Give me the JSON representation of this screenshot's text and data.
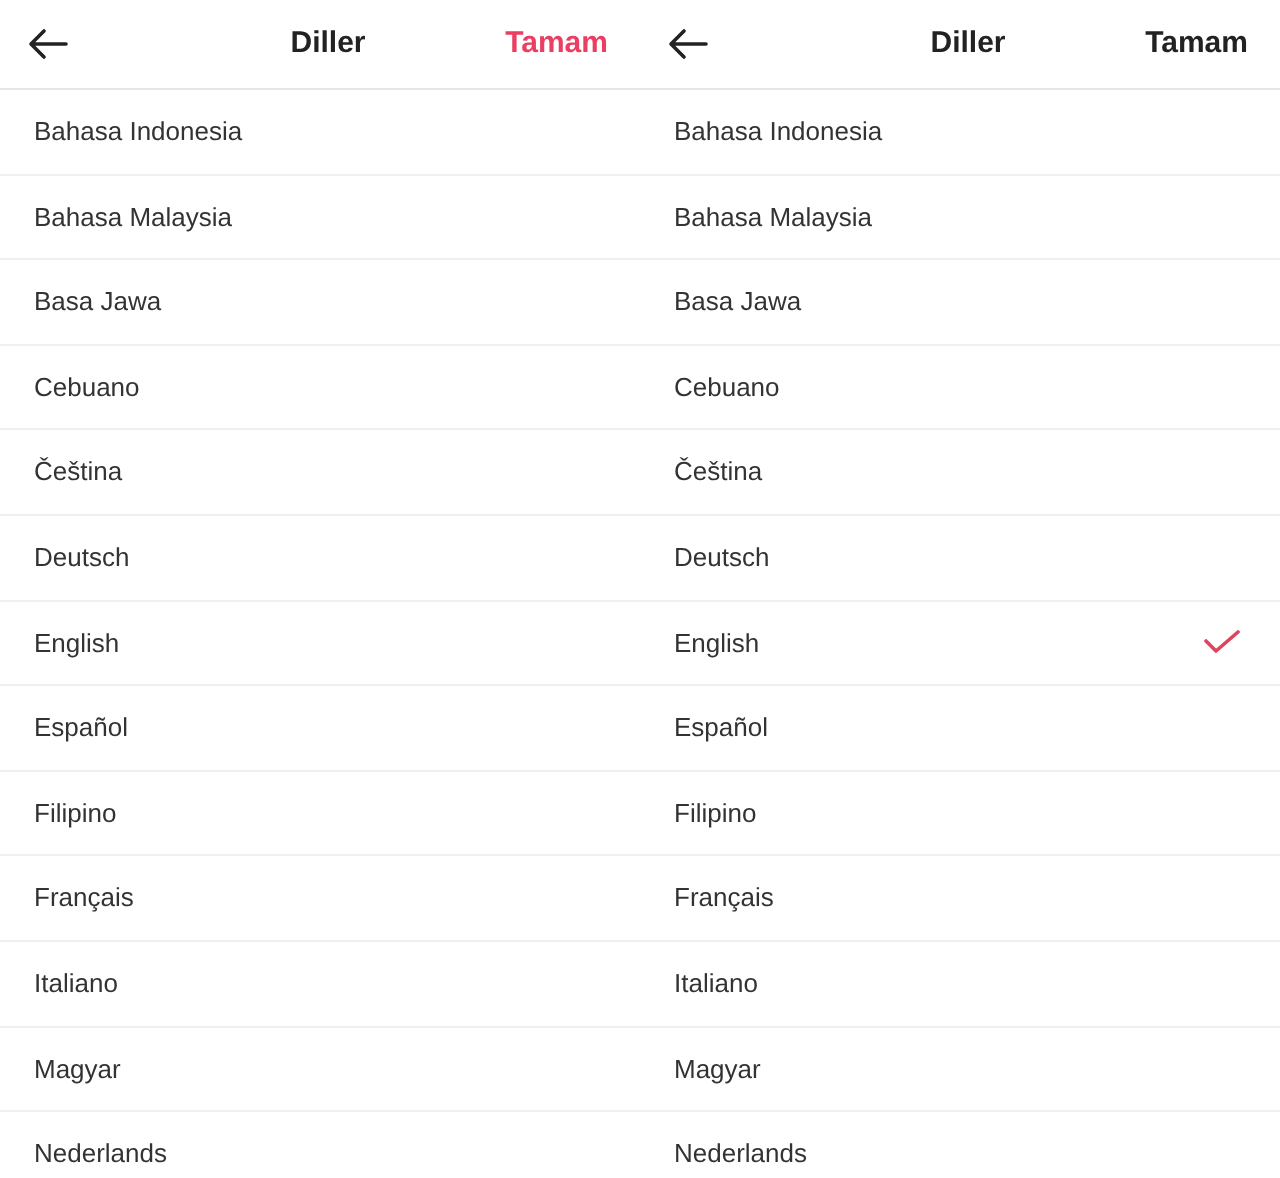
{
  "screens": [
    {
      "header": {
        "title": "Diller",
        "done": {
          "label": "Tamam",
          "active": true
        }
      },
      "languages": [
        {
          "label": "Bahasa Indonesia",
          "selected": false
        },
        {
          "label": "Bahasa Malaysia",
          "selected": false
        },
        {
          "label": "Basa Jawa",
          "selected": false
        },
        {
          "label": "Cebuano",
          "selected": false
        },
        {
          "label": "Čeština",
          "selected": false
        },
        {
          "label": "Deutsch",
          "selected": false
        },
        {
          "label": "English",
          "selected": false
        },
        {
          "label": "Español",
          "selected": false
        },
        {
          "label": "Filipino",
          "selected": false
        },
        {
          "label": "Français",
          "selected": false
        },
        {
          "label": "Italiano",
          "selected": false
        },
        {
          "label": "Magyar",
          "selected": false
        },
        {
          "label": "Nederlands",
          "selected": false
        }
      ]
    },
    {
      "header": {
        "title": "Diller",
        "done": {
          "label": "Tamam",
          "active": false
        }
      },
      "languages": [
        {
          "label": "Bahasa Indonesia",
          "selected": false
        },
        {
          "label": "Bahasa Malaysia",
          "selected": false
        },
        {
          "label": "Basa Jawa",
          "selected": false
        },
        {
          "label": "Cebuano",
          "selected": false
        },
        {
          "label": "Čeština",
          "selected": false
        },
        {
          "label": "Deutsch",
          "selected": false
        },
        {
          "label": "English",
          "selected": true
        },
        {
          "label": "Español",
          "selected": false
        },
        {
          "label": "Filipino",
          "selected": false
        },
        {
          "label": "Français",
          "selected": false
        },
        {
          "label": "Italiano",
          "selected": false
        },
        {
          "label": "Magyar",
          "selected": false
        },
        {
          "label": "Nederlands",
          "selected": false
        }
      ]
    }
  ]
}
